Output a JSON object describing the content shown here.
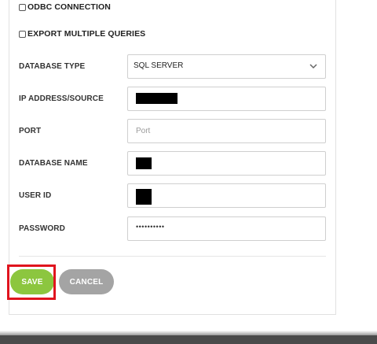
{
  "form": {
    "odbc_label": "ODBC CONNECTION",
    "export_label": "EXPORT MULTIPLE QUERIES",
    "database_type": {
      "label": "DATABASE TYPE",
      "value": "SQL SERVER"
    },
    "ip_address": {
      "label": "IP ADDRESS/SOURCE"
    },
    "port": {
      "label": "PORT",
      "placeholder": "Port"
    },
    "database_name": {
      "label": "DATABASE NAME"
    },
    "user_id": {
      "label": "USER ID"
    },
    "password": {
      "label": "PASSWORD",
      "masked_value": "••••••••••"
    }
  },
  "actions": {
    "save_label": "SAVE",
    "cancel_label": "CANCEL"
  },
  "colors": {
    "save_button": "#8cc63f",
    "cancel_button": "#a4a4a4",
    "highlight": "#e0141e"
  },
  "icons": {
    "dropdown": "chevron-down-icon"
  }
}
